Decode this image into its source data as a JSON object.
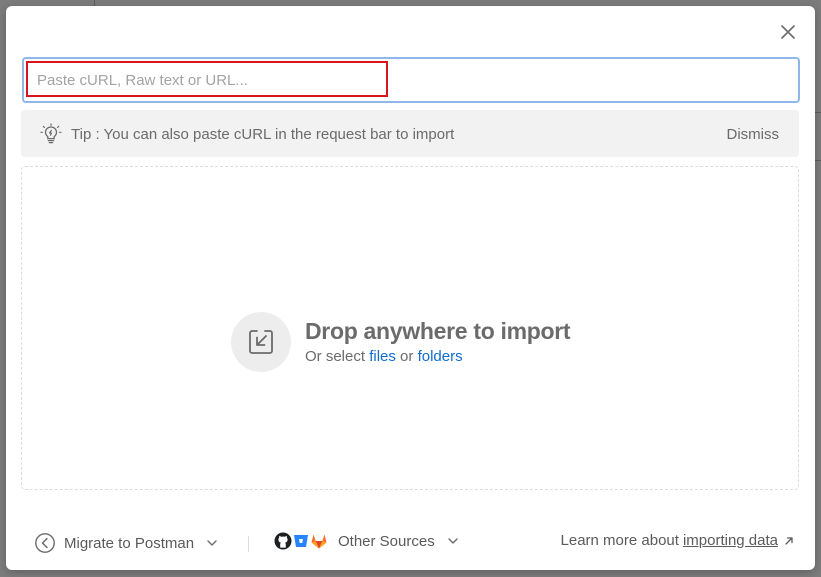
{
  "dialog": {
    "input": {
      "placeholder": "Paste cURL, Raw text or URL...",
      "value": ""
    },
    "tip": {
      "text": "Tip : You can also paste cURL in the request bar to import",
      "dismiss_label": "Dismiss"
    },
    "dropzone": {
      "title": "Drop anywhere to import",
      "sub_prefix": "Or select",
      "files_link": "files",
      "or_text": "or",
      "folders_link": "folders"
    },
    "footer": {
      "migrate_label": "Migrate to Postman",
      "other_sources_label": "Other Sources",
      "learn_prefix": "Learn more about",
      "learn_link": "importing data"
    }
  },
  "colors": {
    "accent_link": "#0f6dd4",
    "input_focus_border": "#8fb7ec",
    "highlight_border": "#d8161e",
    "github": "#1b1f23",
    "bitbucket": "#2684ff",
    "gitlab": "#fc6d26"
  },
  "icons": {
    "close": "close-icon",
    "tip": "lightbulb-icon",
    "drop": "import-tray-icon",
    "migrate": "migrate-arrow-icon",
    "chevron": "chevron-down-icon",
    "github": "github-icon",
    "bitbucket": "bitbucket-icon",
    "gitlab": "gitlab-icon",
    "external": "external-arrow-icon"
  }
}
